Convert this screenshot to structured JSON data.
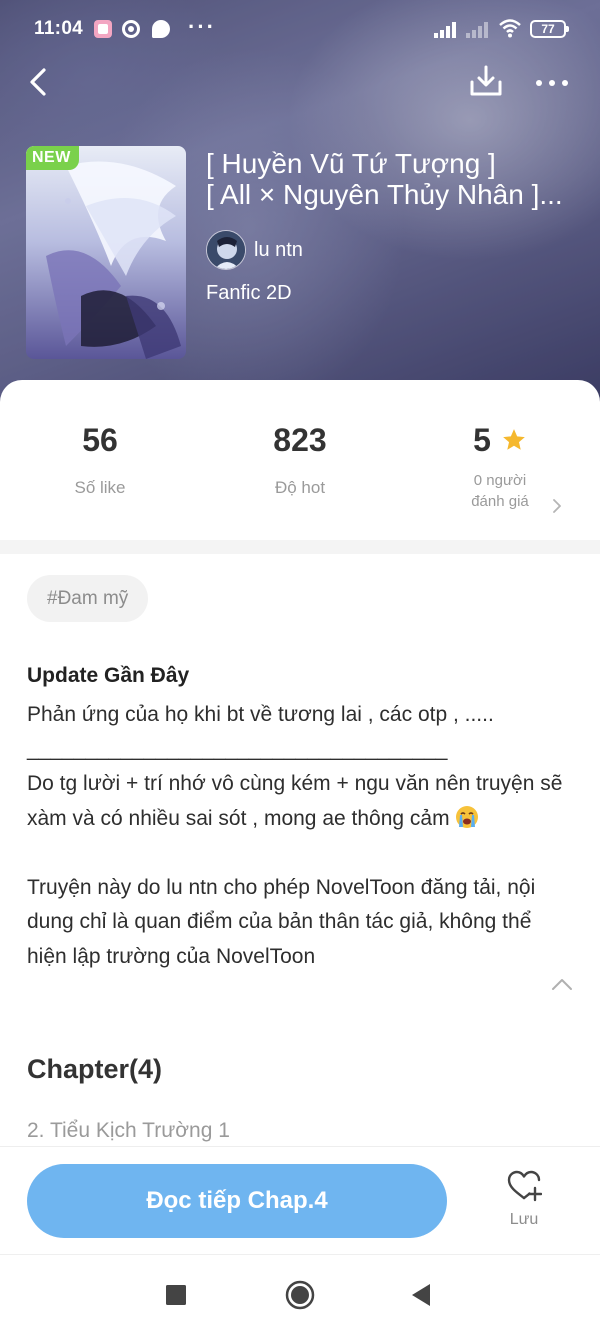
{
  "status_bar": {
    "time": "11:04",
    "battery": "77"
  },
  "book": {
    "badge": "NEW",
    "title_line1": "[ Huyền Vũ Tứ Tượng ]",
    "title_line2": "[ All × Nguyên Thủy Nhân ]...",
    "author": "lu ntn",
    "genre": "Fanfic 2D"
  },
  "stats": {
    "likes_value": "56",
    "likes_label": "Số like",
    "hot_value": "823",
    "hot_label": "Độ hot",
    "rating_value": "5",
    "rating_label_line1": "0 người",
    "rating_label_line2": "đánh giá"
  },
  "tag": "#Đam mỹ",
  "description": {
    "update_title": "Update Gần Đây",
    "line1": "Phản ứng của họ khi bt về tương lai , các otp , .....",
    "line2": "____________________________________",
    "line3": "Do tg lười + trí nhớ vô cùng kém + ngu văn nên truyện sẽ xàm và có nhiều sai sót , mong ae thông cảm",
    "disclaimer": "Truyện này do lu ntn cho phép NovelToon đăng tải, nội dung chỉ là quan điểm của bản thân tác giả, không thể hiện lập trường của NovelToon"
  },
  "chapters": {
    "heading": "Chapter(4)",
    "first_item": "2. Tiểu Kịch Trường 1"
  },
  "actions": {
    "read_button": "Đọc tiếp Chap.4",
    "save_label": "Lưu"
  },
  "colors": {
    "accent": "#6fb5f0",
    "badge": "#7ad14b",
    "star": "#f5b82e"
  },
  "icons": [
    "back-arrow-icon",
    "download-icon",
    "more-icon",
    "star-icon",
    "chevron-right-icon",
    "chevron-up-icon",
    "heart-plus-icon",
    "crying-emoji-icon"
  ]
}
